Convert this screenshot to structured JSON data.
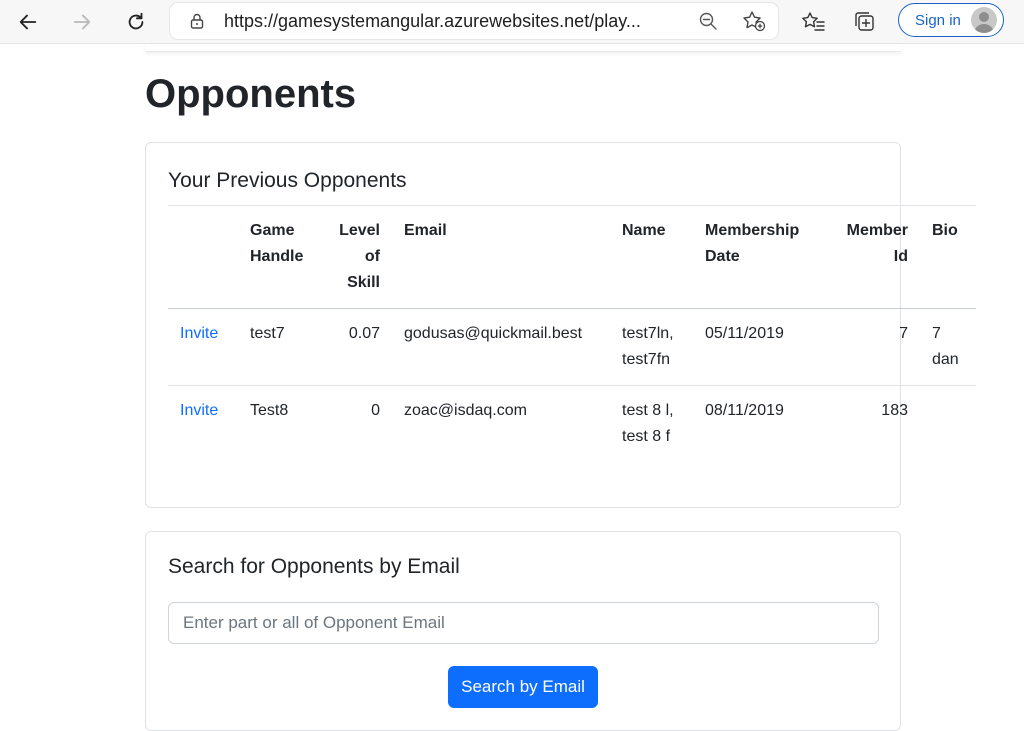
{
  "browser": {
    "url": "https://gamesystemangular.azurewebsites.net/play...",
    "sign_in_label": "Sign in",
    "icons": [
      "back-icon",
      "forward-icon",
      "reload-icon",
      "lock-icon",
      "zoom-icon",
      "add-favorite-icon",
      "favorites-icon",
      "collections-icon",
      "profile-avatar-icon"
    ]
  },
  "page": {
    "title": "Opponents"
  },
  "previous_opponents": {
    "title": "Your Previous Opponents",
    "columns": [
      "",
      "Game Handle",
      "Level of Skill",
      "Email",
      "Name",
      "Membership Date",
      "Member Id",
      "Bio"
    ],
    "rows": [
      {
        "action": "Invite",
        "game_handle": "test7",
        "level_of_skill": "0.07",
        "email": "godusas@quickmail.best",
        "name": "test7ln, test7fn",
        "membership_date": "05/11/2019",
        "member_id": "7",
        "bio": "7 dan"
      },
      {
        "action": "Invite",
        "game_handle": "Test8",
        "level_of_skill": "0",
        "email": "zoac@isdaq.com",
        "name": "test 8 l, test 8 f",
        "membership_date": "08/11/2019",
        "member_id": "183",
        "bio": ""
      }
    ]
  },
  "search": {
    "title": "Search for Opponents by Email",
    "placeholder": "Enter part or all of Opponent Email",
    "value": "",
    "button_label": "Search by Email"
  },
  "colors": {
    "link": "#0d6efd",
    "primary_button": "#0d6efd",
    "sign_in_accent": "#1a62c9"
  }
}
